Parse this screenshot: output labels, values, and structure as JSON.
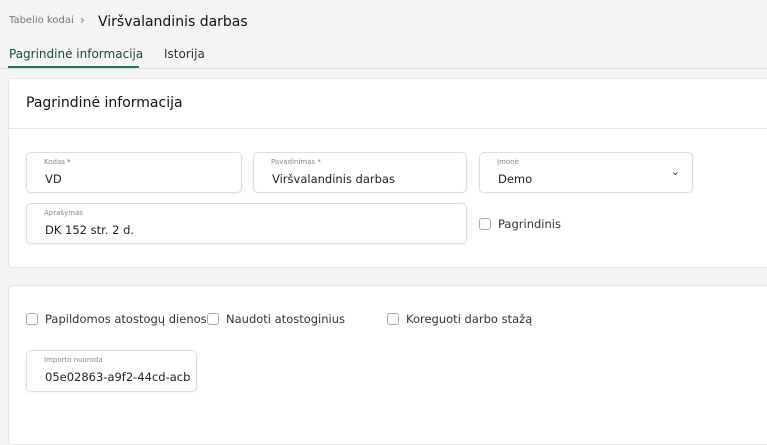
{
  "breadcrumb": {
    "parent": "Tabelio kodai",
    "current": "Viršvalandinis darbas"
  },
  "tabs": [
    {
      "label": "Pagrindinė informacija",
      "active": true
    },
    {
      "label": "Istorija",
      "active": false
    }
  ],
  "card": {
    "title": "Pagrindinė informacija"
  },
  "fields": {
    "kodas": {
      "label": "Kodas",
      "required": "*",
      "value": "VD"
    },
    "pavadinimas": {
      "label": "Pavadinimas",
      "required": "*",
      "value": "Viršvalandinis darbas"
    },
    "imone": {
      "label": "Įmonė",
      "value": "Demo"
    },
    "aprasymas": {
      "label": "Aprašymas",
      "value": "DK 152 str. 2 d."
    },
    "importo": {
      "label": "Importo nuoroda",
      "value": "05e02863-a9f2-44cd-acb"
    }
  },
  "checkboxes": {
    "pagrindinis": "Pagrindinis",
    "papildomos": "Papildomos atostogų dienos",
    "naudoti": "Naudoti atostoginius",
    "koreguoti": "Koreguoti darbo stažą"
  },
  "accent": "#1a7a5a"
}
